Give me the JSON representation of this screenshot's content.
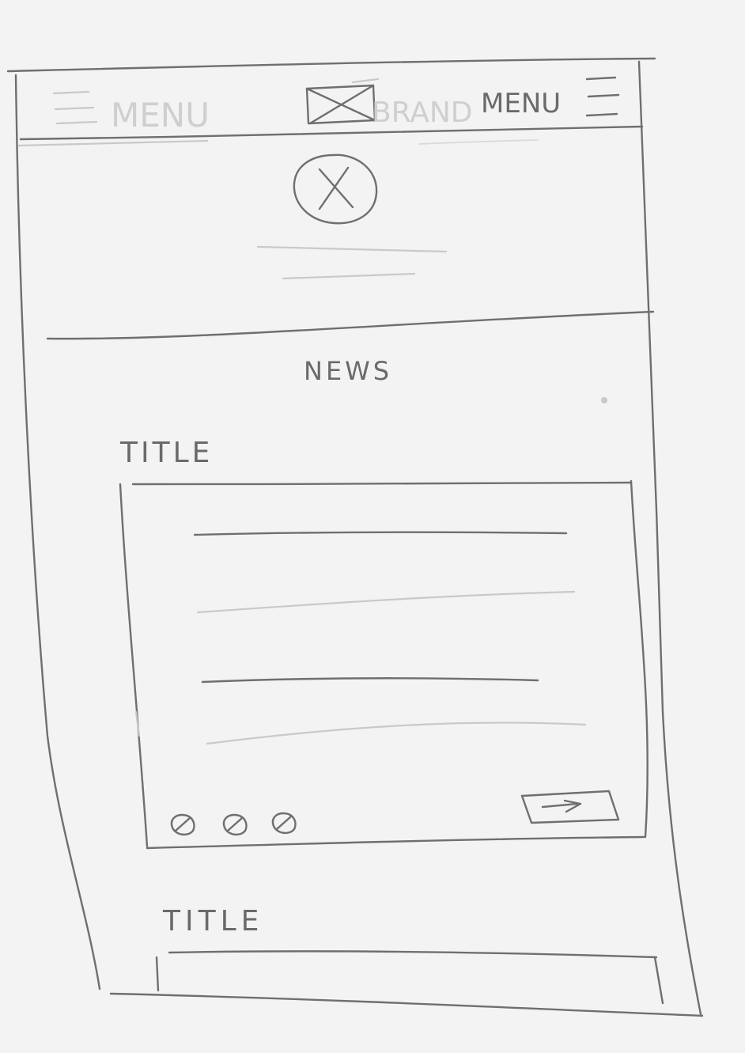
{
  "header": {
    "menu_left_label": "MENU",
    "brand_label": "BRAND",
    "menu_right_label": "MENU"
  },
  "hero": {
    "image_icon": "image-placeholder-icon"
  },
  "section": {
    "heading": "NEWS"
  },
  "articles": [
    {
      "title": "TITLE",
      "social_icons": [
        "share-icon",
        "share-icon",
        "share-icon"
      ],
      "action_icon": "arrow-right-icon"
    },
    {
      "title": "TITLE"
    }
  ]
}
